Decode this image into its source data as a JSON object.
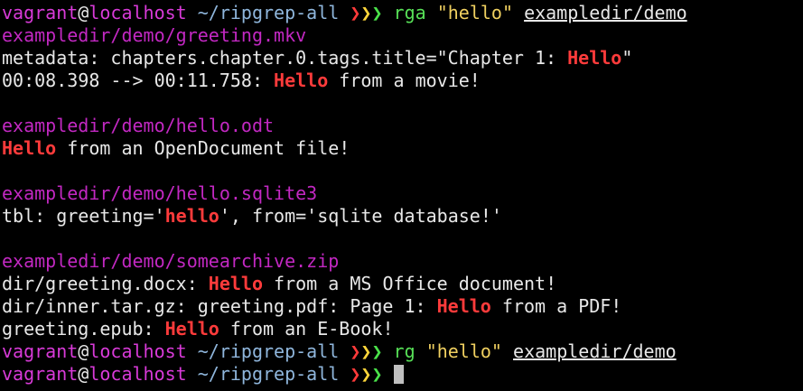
{
  "prompt": {
    "user": "vagrant",
    "at": "@",
    "host": "localhost",
    "dir": "~/ripgrep-all",
    "arrow": "❯",
    "arrow_colors": [
      "#ff3a3a",
      "#ffd63a",
      "#4ae24a"
    ]
  },
  "command1": {
    "program": "rga",
    "query": "\"hello\"",
    "path": "exampledir/demo"
  },
  "results": [
    {
      "file": "exampledir/demo/greeting.mkv",
      "lines": [
        {
          "pre": "metadata: chapters.chapter.0.tags.title=\"Chapter 1: ",
          "match": "Hello",
          "post": "\""
        },
        {
          "pre": "00:08.398 --> 00:11.758: ",
          "match": "Hello",
          "post": " from a movie!"
        }
      ]
    },
    {
      "file": "exampledir/demo/hello.odt",
      "lines": [
        {
          "pre": "",
          "match": "Hello",
          "post": " from an OpenDocument file!"
        }
      ]
    },
    {
      "file": "exampledir/demo/hello.sqlite3",
      "lines": [
        {
          "pre": "tbl: greeting='",
          "match": "hello",
          "post": "', from='sqlite database!'"
        }
      ]
    },
    {
      "file": "exampledir/demo/somearchive.zip",
      "lines": [
        {
          "pre": "dir/greeting.docx: ",
          "match": "Hello",
          "post": " from a MS Office document!"
        },
        {
          "pre": "dir/inner.tar.gz: greeting.pdf: Page 1: ",
          "match": "Hello",
          "post": " from a PDF!"
        },
        {
          "pre": "greeting.epub: ",
          "match": "Hello",
          "post": " from an E-Book!"
        }
      ]
    }
  ],
  "command2": {
    "program": "rg",
    "query": "\"hello\"",
    "path": "exampledir/demo"
  },
  "colors": {
    "background": "#000000",
    "filename": "#c228c2",
    "match": "#ff3b3b",
    "command": "#57e057",
    "path_dir": "#8fb6dc"
  }
}
